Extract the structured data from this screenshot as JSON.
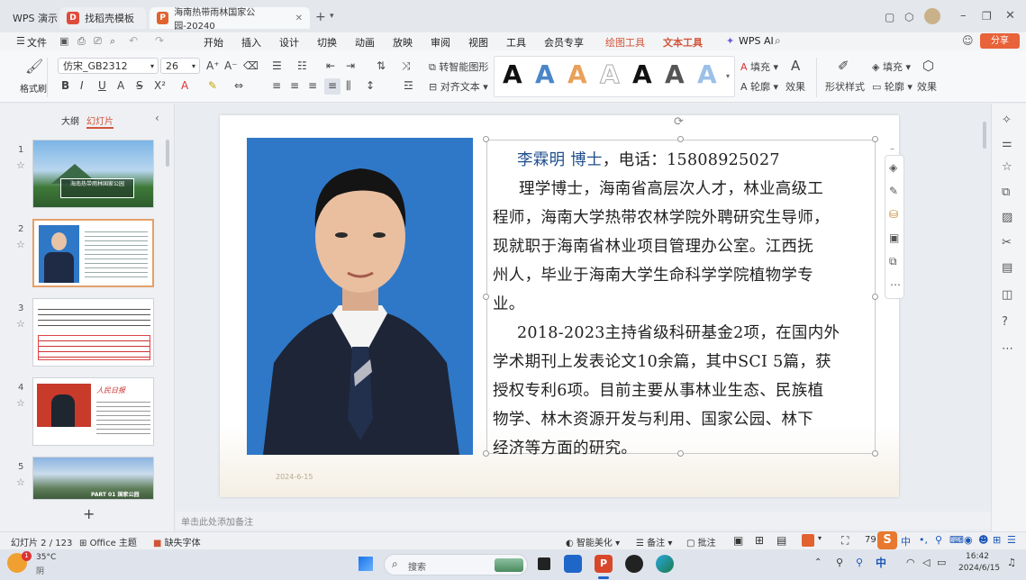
{
  "tabs": [
    {
      "label": "WPS 演示"
    },
    {
      "label": "找稻壳模板"
    },
    {
      "label": "海南热带雨林国家公园-20240"
    }
  ],
  "menu": {
    "file": "文件",
    "items": [
      "开始",
      "插入",
      "设计",
      "切换",
      "动画",
      "放映",
      "审阅",
      "视图",
      "工具",
      "会员专享"
    ],
    "drawing_tools": "绘图工具",
    "text_tools": "文本工具",
    "wps_ai": "WPS AI",
    "share": "分享"
  },
  "ribbon": {
    "format_painter": "格式刷",
    "font_name": "仿宋_GB2312",
    "font_size": "26",
    "smart_shape": "转智能图形",
    "align_text": "对齐文本",
    "fill": "填充",
    "outline": "轮廓",
    "effects": "效果",
    "shape_style": "形状样式",
    "fill2": "填充",
    "outline2": "轮廓",
    "effects2": "效果",
    "text_style_glyph": "A"
  },
  "panel": {
    "outline_tab": "大纲",
    "slides_tab": "幻灯片",
    "slide_numbers": [
      "1",
      "2",
      "3",
      "4",
      "5"
    ],
    "add": "+"
  },
  "thumbs": {
    "t1_title": "海南热带雨林国家公园",
    "t5_text": "PART 01 国家公园"
  },
  "slide": {
    "name_line_name": "李霖明 博士",
    "name_line_phone": "，电话：15808925027",
    "lines": [
      "理学博士，海南省高层次人才，林业高级工",
      "程师，海南大学热带农林学院外聘研究生导师，",
      "现就职于海南省林业项目管理办公室。江西抚",
      "州人，毕业于海南大学生命科学学院植物学专",
      "业。",
      "2018-2023主持省级科研基金2项，在国内外",
      "学术期刊上发表论文10余篇，其中SCI 5篇，获",
      "授权专利6项。目前主要从事林业生态、民族植",
      "物学、林木资源开发与利用、国家公园、林下",
      "经济等方面的研究。"
    ],
    "date": "2024-6-15"
  },
  "notes_placeholder": "单击此处添加备注",
  "status": {
    "slide_count": "幻灯片 2 / 123",
    "theme": "Office 主题",
    "missing_font": "缺失字体",
    "smart_beautify": "智能美化",
    "notes": "备注",
    "comments": "批注",
    "zoom": "79"
  },
  "taskbar": {
    "temp": "35°C",
    "weather": "阴",
    "search": "搜索",
    "time": "16:42",
    "date": "2024/6/15"
  },
  "colors": {
    "accent": "#d2553a",
    "photo_bg": "#2f78c8"
  }
}
